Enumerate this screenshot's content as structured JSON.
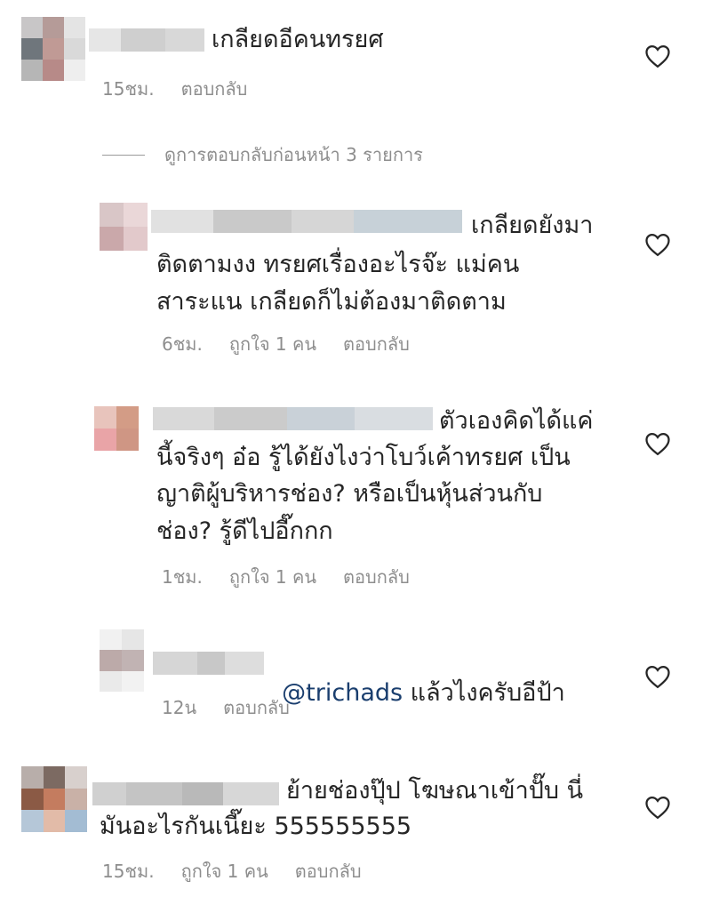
{
  "comments": [
    {
      "lines": [
        "เกลียดอีคนทรยศ"
      ],
      "meta": {
        "time": "15ชม.",
        "reply": "ตอบกลับ"
      }
    },
    {
      "lines": [
        "เกลียดยังมา",
        "ติดตามงง ทรยศเรื่องอะไรจ๊ะ แม่คน",
        "สาระแน เกลียดก็ไม่ต้องมาติดตาม"
      ],
      "meta": {
        "time": "6ชม.",
        "likes": "ถูกใจ 1 คน",
        "reply": "ตอบกลับ"
      }
    },
    {
      "lines": [
        "ตัวเองคิดได้แค่",
        "นี้จริงๆ อ๋อ รู้ได้ยังไงว่าโบว์เค้าทรยศ เป็น",
        "ญาติผู้บริหารช่อง? หรือเป็นหุ้นส่วนกับ",
        "ช่อง? รู้ดีไปอี๊กกก"
      ],
      "meta": {
        "time": "1ชม.",
        "likes": "ถูกใจ 1 คน",
        "reply": "ตอบกลับ"
      }
    },
    {
      "mention": "@trichads",
      "lines": [
        " แล้วไงครับอีป้า"
      ],
      "meta": {
        "time": "12น",
        "reply": "ตอบกลับ"
      }
    },
    {
      "lines": [
        "ย้ายช่องปุ๊ป โฆษณาเข้าปั๊บ นี่",
        "มันอะไรกันเนี๊ยะ 555555555"
      ],
      "meta": {
        "time": "15ชม.",
        "likes": "ถูกใจ 1 คน",
        "reply": "ตอบกลับ"
      }
    }
  ],
  "view_previous": "ดูการตอบกลับก่อนหน้า 3 รายการ",
  "icons": {
    "like": "heart-outline-icon"
  },
  "colors": {
    "text": "#262626",
    "meta": "#8e8e8e",
    "mention": "#1a3e6e"
  }
}
